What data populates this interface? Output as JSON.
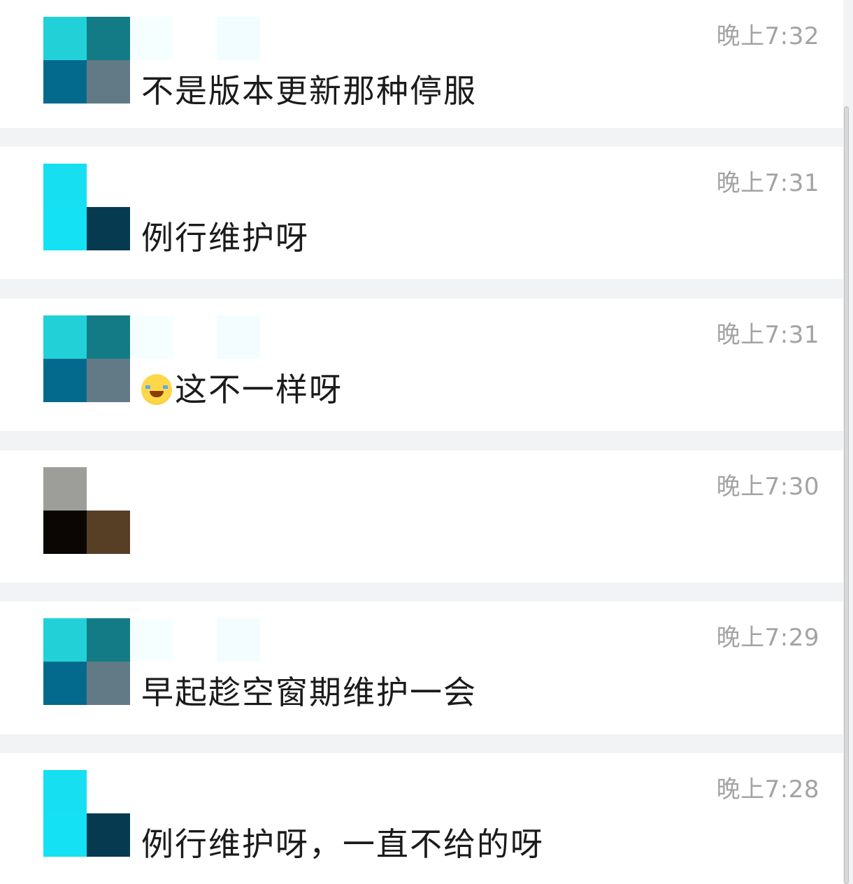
{
  "messages": [
    {
      "time": "晚上7:32",
      "text": "不是版本更新那种停服",
      "avatar": [
        "#22d1d8",
        "#127b86",
        "#046a8d",
        "#627a86"
      ],
      "name_blocks": [
        "#f5ffff",
        "#ffffff",
        "#f2fdff"
      ]
    },
    {
      "time": "晚上7:31",
      "text": "例行维护呀",
      "avatar": [
        "#16dff2",
        "#ffffff",
        "#14e2f4",
        "#063a51"
      ],
      "name_blocks": []
    },
    {
      "time": "晚上7:31",
      "emoji": "grinning-face-with-tears-of-joy",
      "text": "这不一样呀",
      "avatar": [
        "#22d1d8",
        "#127b86",
        "#046a8d",
        "#627a86"
      ],
      "name_blocks": [
        "#f6ffff",
        "#ffffff",
        "#f3fdff"
      ]
    },
    {
      "time": "晚上7:30",
      "text": "",
      "avatar": [
        "#9d9d9a",
        "#ffffff",
        "#0b0604",
        "#573f26"
      ],
      "name_blocks": []
    },
    {
      "time": "晚上7:29",
      "text": "早起趁空窗期维护一会",
      "avatar": [
        "#22d1d8",
        "#127b86",
        "#046a8d",
        "#627a86"
      ],
      "name_blocks": [
        "#f6ffff",
        "#ffffff",
        "#f3fdff"
      ]
    },
    {
      "time": "晚上7:28",
      "text": "例行维护呀，一直不给的呀",
      "avatar": [
        "#16dff2",
        "#ffffff",
        "#14e2f4",
        "#063a51"
      ],
      "name_blocks": []
    }
  ]
}
